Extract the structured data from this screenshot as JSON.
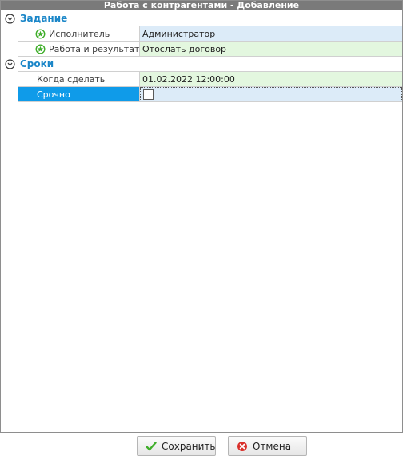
{
  "window": {
    "title": "Работа с контрагентами - Добавление"
  },
  "groups": [
    {
      "title": "Задание",
      "rows": [
        {
          "label": "Исполнитель",
          "value": "Администратор",
          "required": true,
          "value_style": "blue"
        },
        {
          "label": "Работа и результат",
          "value": "Отослать договор",
          "required": true,
          "value_style": "green"
        }
      ]
    },
    {
      "title": "Сроки",
      "rows": [
        {
          "label": "Когда сделать",
          "value": "01.02.2022 12:00:00",
          "required": false,
          "value_style": "green"
        },
        {
          "label": "Срочно",
          "value": "",
          "required": false,
          "value_style": "checkbox",
          "checked": false,
          "selected": true
        }
      ]
    }
  ],
  "buttons": {
    "save_label": "Сохранить",
    "cancel_label": "Отмена"
  },
  "icons": {
    "group_toggle": "collapse-circle-icon",
    "required": "required-star-icon",
    "save": "check-icon",
    "cancel": "cancel-icon"
  },
  "colors": {
    "title_bar": "#7a7a7a",
    "group_title": "#1a86c8",
    "selected_label": "#0f9be9",
    "value_blue": "#dcebf8",
    "value_green": "#e3f7df",
    "required_icon": "#3fae2a",
    "cancel_icon": "#d9302b"
  }
}
